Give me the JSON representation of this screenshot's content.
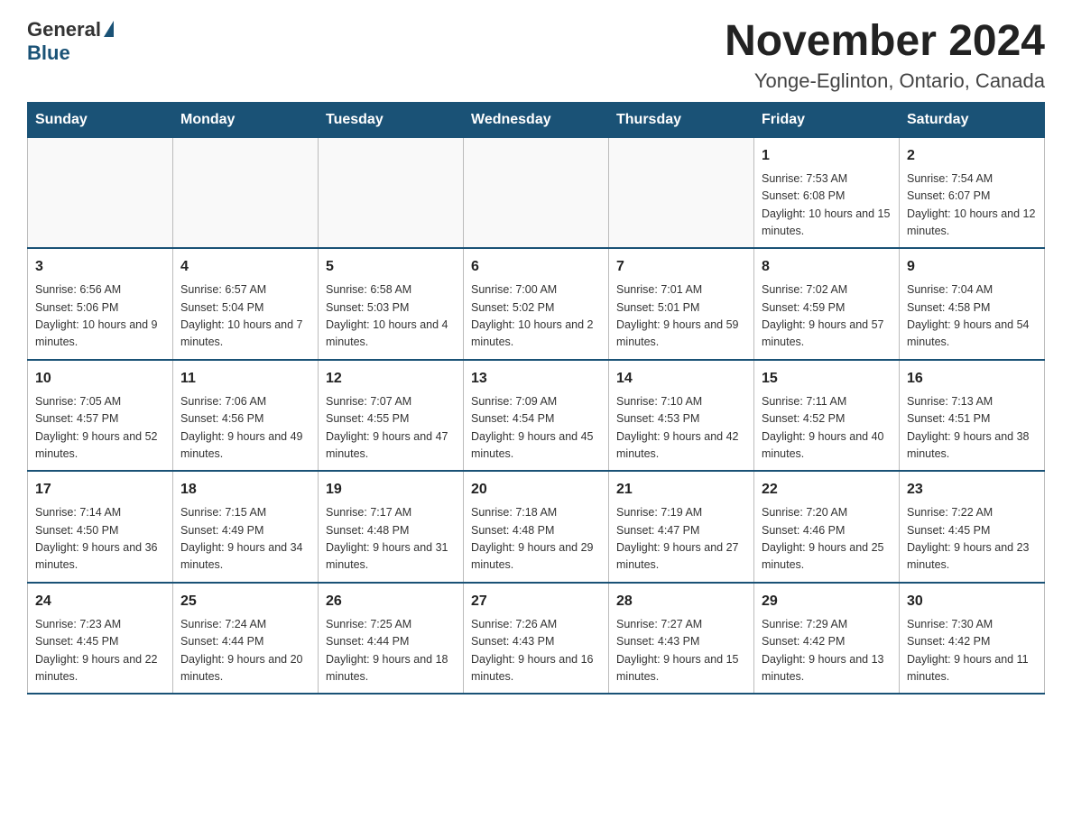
{
  "header": {
    "logo_general": "General",
    "logo_blue": "Blue",
    "title": "November 2024",
    "subtitle": "Yonge-Eglinton, Ontario, Canada"
  },
  "calendar": {
    "days_of_week": [
      "Sunday",
      "Monday",
      "Tuesday",
      "Wednesday",
      "Thursday",
      "Friday",
      "Saturday"
    ],
    "weeks": [
      [
        {
          "date": "",
          "sunrise": "",
          "sunset": "",
          "daylight": ""
        },
        {
          "date": "",
          "sunrise": "",
          "sunset": "",
          "daylight": ""
        },
        {
          "date": "",
          "sunrise": "",
          "sunset": "",
          "daylight": ""
        },
        {
          "date": "",
          "sunrise": "",
          "sunset": "",
          "daylight": ""
        },
        {
          "date": "",
          "sunrise": "",
          "sunset": "",
          "daylight": ""
        },
        {
          "date": "1",
          "sunrise": "Sunrise: 7:53 AM",
          "sunset": "Sunset: 6:08 PM",
          "daylight": "Daylight: 10 hours and 15 minutes."
        },
        {
          "date": "2",
          "sunrise": "Sunrise: 7:54 AM",
          "sunset": "Sunset: 6:07 PM",
          "daylight": "Daylight: 10 hours and 12 minutes."
        }
      ],
      [
        {
          "date": "3",
          "sunrise": "Sunrise: 6:56 AM",
          "sunset": "Sunset: 5:06 PM",
          "daylight": "Daylight: 10 hours and 9 minutes."
        },
        {
          "date": "4",
          "sunrise": "Sunrise: 6:57 AM",
          "sunset": "Sunset: 5:04 PM",
          "daylight": "Daylight: 10 hours and 7 minutes."
        },
        {
          "date": "5",
          "sunrise": "Sunrise: 6:58 AM",
          "sunset": "Sunset: 5:03 PM",
          "daylight": "Daylight: 10 hours and 4 minutes."
        },
        {
          "date": "6",
          "sunrise": "Sunrise: 7:00 AM",
          "sunset": "Sunset: 5:02 PM",
          "daylight": "Daylight: 10 hours and 2 minutes."
        },
        {
          "date": "7",
          "sunrise": "Sunrise: 7:01 AM",
          "sunset": "Sunset: 5:01 PM",
          "daylight": "Daylight: 9 hours and 59 minutes."
        },
        {
          "date": "8",
          "sunrise": "Sunrise: 7:02 AM",
          "sunset": "Sunset: 4:59 PM",
          "daylight": "Daylight: 9 hours and 57 minutes."
        },
        {
          "date": "9",
          "sunrise": "Sunrise: 7:04 AM",
          "sunset": "Sunset: 4:58 PM",
          "daylight": "Daylight: 9 hours and 54 minutes."
        }
      ],
      [
        {
          "date": "10",
          "sunrise": "Sunrise: 7:05 AM",
          "sunset": "Sunset: 4:57 PM",
          "daylight": "Daylight: 9 hours and 52 minutes."
        },
        {
          "date": "11",
          "sunrise": "Sunrise: 7:06 AM",
          "sunset": "Sunset: 4:56 PM",
          "daylight": "Daylight: 9 hours and 49 minutes."
        },
        {
          "date": "12",
          "sunrise": "Sunrise: 7:07 AM",
          "sunset": "Sunset: 4:55 PM",
          "daylight": "Daylight: 9 hours and 47 minutes."
        },
        {
          "date": "13",
          "sunrise": "Sunrise: 7:09 AM",
          "sunset": "Sunset: 4:54 PM",
          "daylight": "Daylight: 9 hours and 45 minutes."
        },
        {
          "date": "14",
          "sunrise": "Sunrise: 7:10 AM",
          "sunset": "Sunset: 4:53 PM",
          "daylight": "Daylight: 9 hours and 42 minutes."
        },
        {
          "date": "15",
          "sunrise": "Sunrise: 7:11 AM",
          "sunset": "Sunset: 4:52 PM",
          "daylight": "Daylight: 9 hours and 40 minutes."
        },
        {
          "date": "16",
          "sunrise": "Sunrise: 7:13 AM",
          "sunset": "Sunset: 4:51 PM",
          "daylight": "Daylight: 9 hours and 38 minutes."
        }
      ],
      [
        {
          "date": "17",
          "sunrise": "Sunrise: 7:14 AM",
          "sunset": "Sunset: 4:50 PM",
          "daylight": "Daylight: 9 hours and 36 minutes."
        },
        {
          "date": "18",
          "sunrise": "Sunrise: 7:15 AM",
          "sunset": "Sunset: 4:49 PM",
          "daylight": "Daylight: 9 hours and 34 minutes."
        },
        {
          "date": "19",
          "sunrise": "Sunrise: 7:17 AM",
          "sunset": "Sunset: 4:48 PM",
          "daylight": "Daylight: 9 hours and 31 minutes."
        },
        {
          "date": "20",
          "sunrise": "Sunrise: 7:18 AM",
          "sunset": "Sunset: 4:48 PM",
          "daylight": "Daylight: 9 hours and 29 minutes."
        },
        {
          "date": "21",
          "sunrise": "Sunrise: 7:19 AM",
          "sunset": "Sunset: 4:47 PM",
          "daylight": "Daylight: 9 hours and 27 minutes."
        },
        {
          "date": "22",
          "sunrise": "Sunrise: 7:20 AM",
          "sunset": "Sunset: 4:46 PM",
          "daylight": "Daylight: 9 hours and 25 minutes."
        },
        {
          "date": "23",
          "sunrise": "Sunrise: 7:22 AM",
          "sunset": "Sunset: 4:45 PM",
          "daylight": "Daylight: 9 hours and 23 minutes."
        }
      ],
      [
        {
          "date": "24",
          "sunrise": "Sunrise: 7:23 AM",
          "sunset": "Sunset: 4:45 PM",
          "daylight": "Daylight: 9 hours and 22 minutes."
        },
        {
          "date": "25",
          "sunrise": "Sunrise: 7:24 AM",
          "sunset": "Sunset: 4:44 PM",
          "daylight": "Daylight: 9 hours and 20 minutes."
        },
        {
          "date": "26",
          "sunrise": "Sunrise: 7:25 AM",
          "sunset": "Sunset: 4:44 PM",
          "daylight": "Daylight: 9 hours and 18 minutes."
        },
        {
          "date": "27",
          "sunrise": "Sunrise: 7:26 AM",
          "sunset": "Sunset: 4:43 PM",
          "daylight": "Daylight: 9 hours and 16 minutes."
        },
        {
          "date": "28",
          "sunrise": "Sunrise: 7:27 AM",
          "sunset": "Sunset: 4:43 PM",
          "daylight": "Daylight: 9 hours and 15 minutes."
        },
        {
          "date": "29",
          "sunrise": "Sunrise: 7:29 AM",
          "sunset": "Sunset: 4:42 PM",
          "daylight": "Daylight: 9 hours and 13 minutes."
        },
        {
          "date": "30",
          "sunrise": "Sunrise: 7:30 AM",
          "sunset": "Sunset: 4:42 PM",
          "daylight": "Daylight: 9 hours and 11 minutes."
        }
      ]
    ]
  }
}
